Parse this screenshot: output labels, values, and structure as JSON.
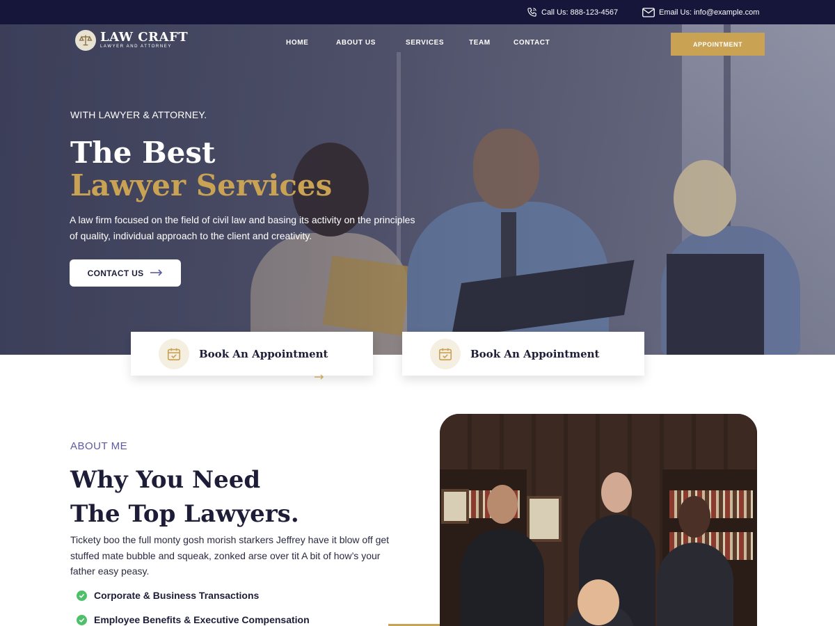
{
  "topbar": {
    "phone": "Call Us: 888-123-4567",
    "email": "Email Us: info@example.com"
  },
  "brand": {
    "name": "LAW CRAFT",
    "tagline": "LAWYER AND ATTORNEY"
  },
  "nav": {
    "items": [
      {
        "label": "HOME"
      },
      {
        "label": "ABOUT US"
      },
      {
        "label": "SERVICES"
      },
      {
        "label": "TEAM"
      },
      {
        "label": "CONTACT"
      }
    ],
    "cta": "APPOINTMENT"
  },
  "hero": {
    "kicker": "WITH LAWYER & ATTORNEY.",
    "title_line1": "The Best",
    "title_line2": "Lawyer Services",
    "description": "A law firm focused on the field of civil law and basing its activity on the principles of quality, individual approach to the client and creativity.",
    "button": "CONTACT US"
  },
  "cards": [
    {
      "label": "Book An Appointment"
    },
    {
      "label": "Book An Appointment"
    }
  ],
  "about": {
    "kicker": "ABOUT ME",
    "title_line1": "Why You Need",
    "title_line2": "The Top Lawyers.",
    "description": "Tickety boo the full monty gosh morish starkers Jeffrey have it blow off get stuffed mate bubble and squeak, zonked arse  over tit A bit of how’s your father easy peasy.",
    "features": [
      {
        "label": "Corporate & Business Transactions"
      },
      {
        "label": "Employee Benefits & Executive Compensation"
      }
    ]
  },
  "colors": {
    "navy": "#15163a",
    "gold": "#c9a353",
    "accent_purple": "#5d5aa0",
    "check_green": "#4fbf6a"
  },
  "icons": {
    "phone": "phone-icon",
    "email": "mail-icon",
    "logo": "scales-of-justice-icon",
    "arrow": "arrow-right-icon",
    "calendar": "calendar-check-icon",
    "check": "check-circle-icon"
  }
}
